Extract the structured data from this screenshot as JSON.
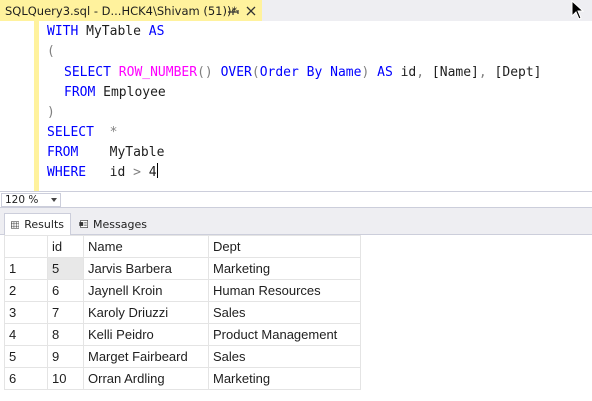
{
  "document_tab": {
    "title": "SQLQuery3.sql - D...HCK4\\Shivam (51))*"
  },
  "editor": {
    "line1": {
      "kw1": "WITH",
      "name": "MyTable",
      "kw2": "AS"
    },
    "line2": {
      "paren": "("
    },
    "line3": {
      "kw_select": "SELECT",
      "fn_row_number": "ROW_NUMBER",
      "parens": "()",
      "kw_over": "OVER",
      "open": "(",
      "kw_order_by": "Order By",
      "col_name": "Name",
      "close": ")",
      "kw_as": "AS",
      "alias": "id",
      "comma1": ",",
      "col2": "[Name]",
      "comma2": ",",
      "col3": "[Dept]"
    },
    "line4": {
      "kw_from": "FROM",
      "table": "Employee"
    },
    "line5": {
      "paren": ")"
    },
    "line6": {
      "kw_select": "SELECT",
      "star": "*"
    },
    "line7": {
      "kw_from": "FROM",
      "table": "MyTable"
    },
    "line8": {
      "kw_where": "WHERE",
      "col": "id",
      "op": ">",
      "value": "4"
    }
  },
  "zoom": {
    "value": "120 %"
  },
  "result_tabs": {
    "results_label": "Results",
    "messages_label": "Messages"
  },
  "results": {
    "columns": [
      "id",
      "Name",
      "Dept"
    ],
    "rows": [
      {
        "rownum": "1",
        "id": "5",
        "name": "Jarvis Barbera",
        "dept": "Marketing"
      },
      {
        "rownum": "2",
        "id": "6",
        "name": "Jaynell Kroin",
        "dept": "Human Resources"
      },
      {
        "rownum": "3",
        "id": "7",
        "name": "Karoly Driuzzi",
        "dept": "Sales"
      },
      {
        "rownum": "4",
        "id": "8",
        "name": "Kelli Peidro",
        "dept": "Product Management"
      },
      {
        "rownum": "5",
        "id": "9",
        "name": "Marget Fairbeard",
        "dept": "Sales"
      },
      {
        "rownum": "6",
        "id": "10",
        "name": "Orran Ardling",
        "dept": "Marketing"
      }
    ]
  },
  "colors": {
    "tab_active": "#fff29d",
    "keyword": "#0000ff",
    "function": "#ff00ff",
    "operator": "#808080"
  }
}
